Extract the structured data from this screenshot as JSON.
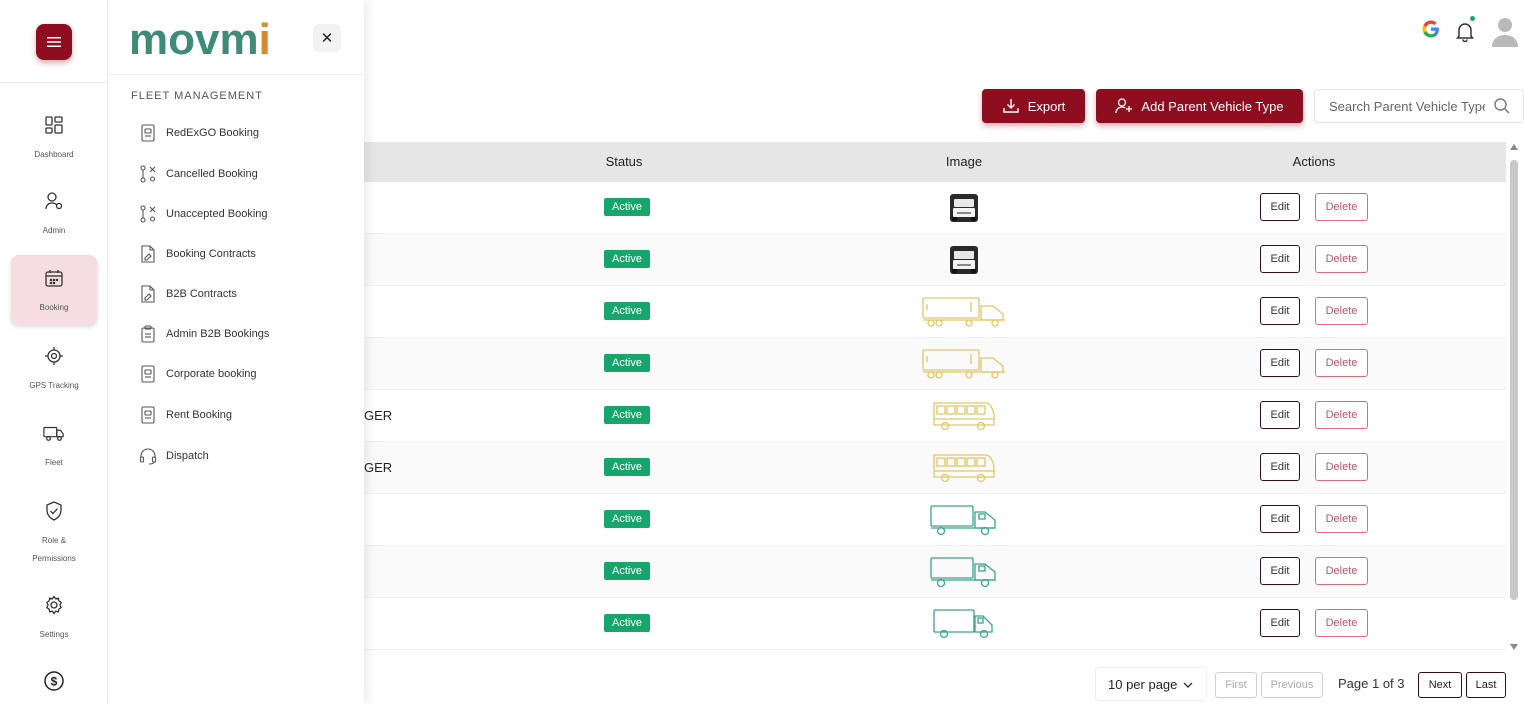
{
  "brand": {
    "logo_main": "movm",
    "logo_accent": "i"
  },
  "rail": {
    "items": [
      {
        "label": "Dashboard",
        "icon": "dashboard-icon"
      },
      {
        "label": "Admin",
        "icon": "admin-icon"
      },
      {
        "label": "Booking",
        "icon": "calendar-icon"
      },
      {
        "label": "GPS Tracking",
        "icon": "gps-icon"
      },
      {
        "label": "Fleet",
        "icon": "truck-icon"
      },
      {
        "label": "Role &",
        "label2": "Permissions",
        "icon": "shield-icon"
      },
      {
        "label": "Settings",
        "icon": "gear-icon"
      },
      {
        "label": "",
        "icon": "dollar-icon"
      }
    ]
  },
  "drawer": {
    "heading": "FLEET MANAGEMENT",
    "close_glyph": "✕",
    "items": [
      {
        "label": "RedExGO Booking"
      },
      {
        "label": "Cancelled Booking"
      },
      {
        "label": "Unaccepted Booking"
      },
      {
        "label": "Booking Contracts"
      },
      {
        "label": "B2B Contracts"
      },
      {
        "label": "Admin B2B Bookings"
      },
      {
        "label": "Corporate booking"
      },
      {
        "label": "Rent Booking"
      },
      {
        "label": "Dispatch"
      }
    ]
  },
  "toolbar": {
    "export_label": "Export",
    "add_label": "Add Parent Vehicle Type",
    "search_placeholder": "Search Parent Vehicle Type"
  },
  "table": {
    "headers": {
      "status": "Status",
      "image": "Image",
      "actions": "Actions"
    },
    "rows": [
      {
        "name": "",
        "status": "Active",
        "image": "van-photo"
      },
      {
        "name": "",
        "status": "Active",
        "image": "van-photo"
      },
      {
        "name": "",
        "status": "Active",
        "image": "trailer-truck-yellow"
      },
      {
        "name": "",
        "status": "Active",
        "image": "trailer-truck-yellow"
      },
      {
        "name": "GER",
        "status": "Active",
        "image": "bus-yellow"
      },
      {
        "name": "GER",
        "status": "Active",
        "image": "bus-yellow"
      },
      {
        "name": "",
        "status": "Active",
        "image": "box-truck-teal"
      },
      {
        "name": "",
        "status": "Active",
        "image": "box-truck-teal"
      },
      {
        "name": "",
        "status": "Active",
        "image": "small-truck-teal"
      }
    ],
    "edit_label": "Edit",
    "delete_label": "Delete"
  },
  "pagination": {
    "per_page": "10 per page",
    "first": "First",
    "previous": "Previous",
    "info": "Page 1 of 3",
    "next": "Next",
    "last": "Last"
  },
  "colors": {
    "brand": "#8e0e1f",
    "active_badge": "#16a56a",
    "logo_main": "#3f8b7a",
    "logo_accent": "#d58a2e"
  }
}
